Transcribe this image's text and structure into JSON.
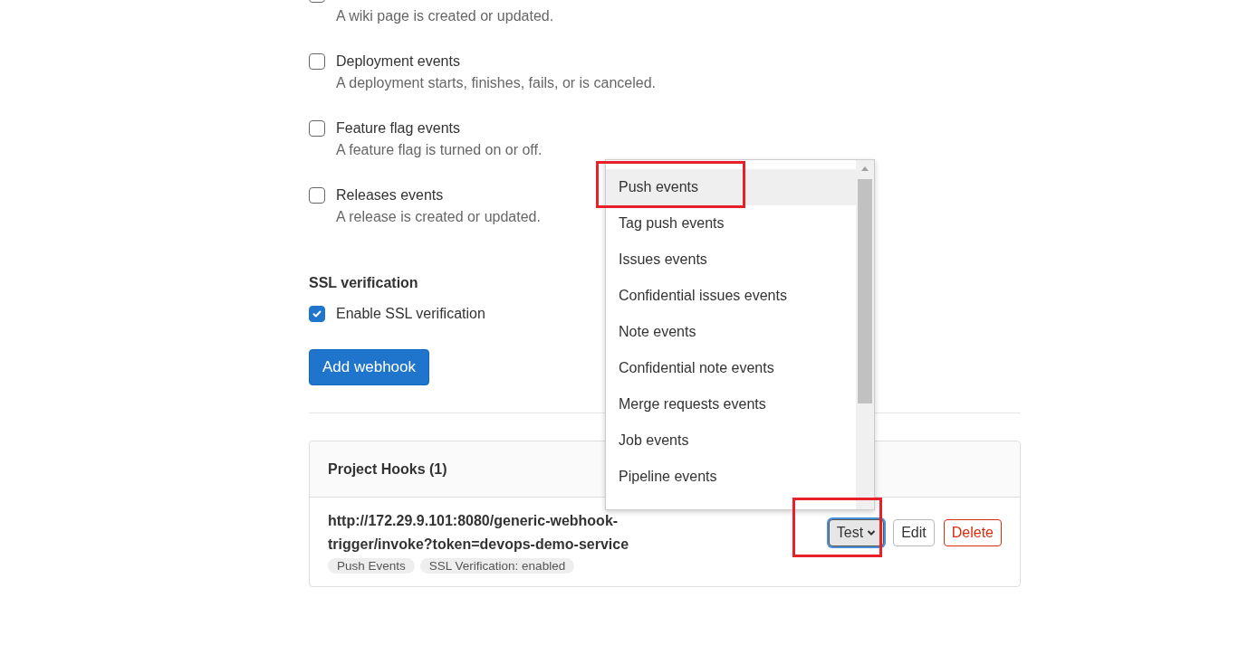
{
  "event_options": [
    {
      "description": "A wiki page is created or updated.",
      "checked": false
    },
    {
      "label": "Deployment events",
      "description": "A deployment starts, finishes, fails, or is canceled.",
      "checked": false
    },
    {
      "label": "Feature flag events",
      "description": "A feature flag is turned on or off.",
      "checked": false
    },
    {
      "label": "Releases events",
      "description": "A release is created or updated.",
      "checked": false
    }
  ],
  "ssl": {
    "heading": "SSL verification",
    "label": "Enable SSL verification",
    "checked": true
  },
  "add_button": "Add webhook",
  "hooks": {
    "title": "Project Hooks (1)",
    "items": [
      {
        "url": "http://172.29.9.101:8080/generic-webhook-trigger/invoke?token=devops-demo-service",
        "tags": [
          "Push Events",
          "SSL Verification: enabled"
        ],
        "buttons": [
          {
            "kind": "test",
            "label": "Test",
            "focused": true,
            "highlight": true
          },
          {
            "kind": "edit",
            "label": "Edit",
            "focused": false,
            "highlight": false
          },
          {
            "kind": "delete",
            "label": "Delete",
            "focused": false,
            "highlight": false
          }
        ]
      }
    ]
  },
  "test_menu": {
    "items": [
      {
        "label": "Push events",
        "selected": true,
        "highlight": true
      },
      {
        "label": "Tag push events",
        "selected": false,
        "highlight": false
      },
      {
        "label": "Issues events",
        "selected": false,
        "highlight": false
      },
      {
        "label": "Confidential issues events",
        "selected": false,
        "highlight": false
      },
      {
        "label": "Note events",
        "selected": false,
        "highlight": false
      },
      {
        "label": "Confidential note events",
        "selected": false,
        "highlight": false
      },
      {
        "label": "Merge requests events",
        "selected": false,
        "highlight": false
      },
      {
        "label": "Job events",
        "selected": false,
        "highlight": false
      },
      {
        "label": "Pipeline events",
        "selected": false,
        "highlight": false
      }
    ]
  }
}
